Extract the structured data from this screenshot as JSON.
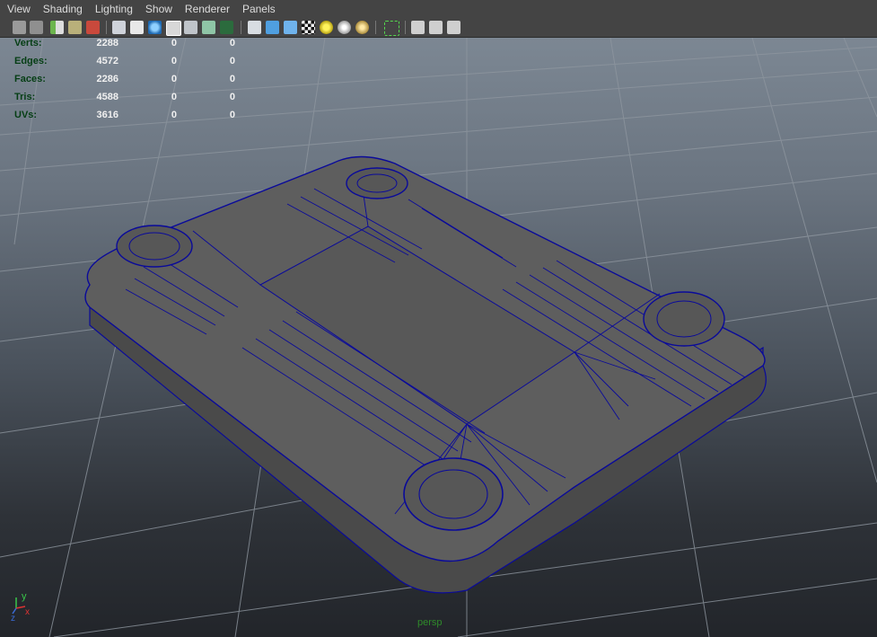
{
  "menu": [
    "View",
    "Shading",
    "Lighting",
    "Show",
    "Renderer",
    "Panels"
  ],
  "toolbar_icons": [
    "camera-select-icon",
    "camera-attributes-icon",
    "bookmark-icon",
    "image-plane-icon",
    "grease-pencil-icon",
    "wireframe-icon",
    "smooth-shade-icon",
    "wireframe-on-shaded-icon",
    "xray-icon",
    "xray-joints-icon",
    "texture-icon",
    "default-material-icon",
    "flat-lighting-icon",
    "isolate-select-icon",
    "high-quality-icon",
    "shadows-icon",
    "light-yellow-icon",
    "light-gray-icon",
    "light-gold-icon",
    "select-camera-icon",
    "single-view-icon",
    "two-view-icon",
    "network-icon"
  ],
  "hud": {
    "rows": [
      {
        "label": "Verts:",
        "values": [
          "2288",
          "0",
          "0"
        ]
      },
      {
        "label": "Edges:",
        "values": [
          "4572",
          "0",
          "0"
        ]
      },
      {
        "label": "Faces:",
        "values": [
          "2286",
          "0",
          "0"
        ]
      },
      {
        "label": "Tris:",
        "values": [
          "4588",
          "0",
          "0"
        ]
      },
      {
        "label": "UVs:",
        "values": [
          "3616",
          "0",
          "0"
        ]
      }
    ]
  },
  "camera_label": "persp",
  "axis": {
    "y": "y",
    "x": "x",
    "z": "z"
  },
  "colors": {
    "wireframe": "#0a0a9a",
    "mesh_top": "#5d5d5d",
    "mesh_side": "#4c4c4c",
    "grid": "#8e969f",
    "hud_label": "#053e14",
    "hud_value": "#f0f0f0",
    "persp_label": "#2f8a2a"
  }
}
